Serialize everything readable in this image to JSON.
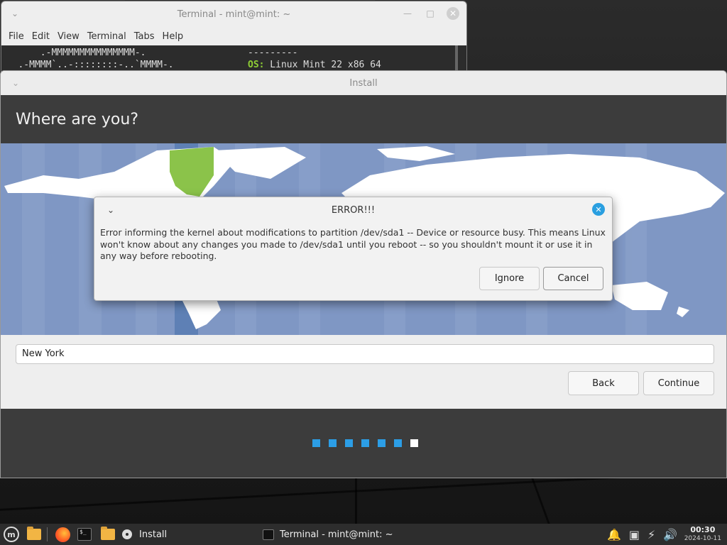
{
  "terminal": {
    "title": "Terminal - mint@mint: ~",
    "menu": [
      "File",
      "Edit",
      "View",
      "Terminal",
      "Tabs",
      "Help"
    ],
    "lines": [
      "       .-MMMMMMMMMMMMMMM-.",
      "   .-MMMM`..-::::::::-..`MMMM-."
    ],
    "right_sep": "---------",
    "os_label": "OS:",
    "os_value": " Linux Mint 22 x86 64"
  },
  "install": {
    "title": "Install",
    "heading": "Where are you?",
    "location_value": "New York",
    "back_label": "Back",
    "continue_label": "Continue",
    "progress": {
      "total": 7,
      "current": 7
    }
  },
  "error_dialog": {
    "title": "ERROR!!!",
    "message": "Error informing the kernel about modifications to partition /dev/sda1 -- Device or resource busy. This means Linux won't know about any changes you made to /dev/sda1 until you reboot -- so you shouldn't mount it or use it in any way before rebooting.",
    "ignore_label": "Ignore",
    "cancel_label": "Cancel"
  },
  "taskbar": {
    "install_label": "Install",
    "terminal_label": "Terminal - mint@mint: ~",
    "time": "00:30",
    "date": "2024-10-11"
  },
  "colors": {
    "accent": "#2c9ee6",
    "header_bg": "#3c3c3c",
    "map_water": "#7f97c4",
    "timezone_highlight": "#8bc34a"
  }
}
